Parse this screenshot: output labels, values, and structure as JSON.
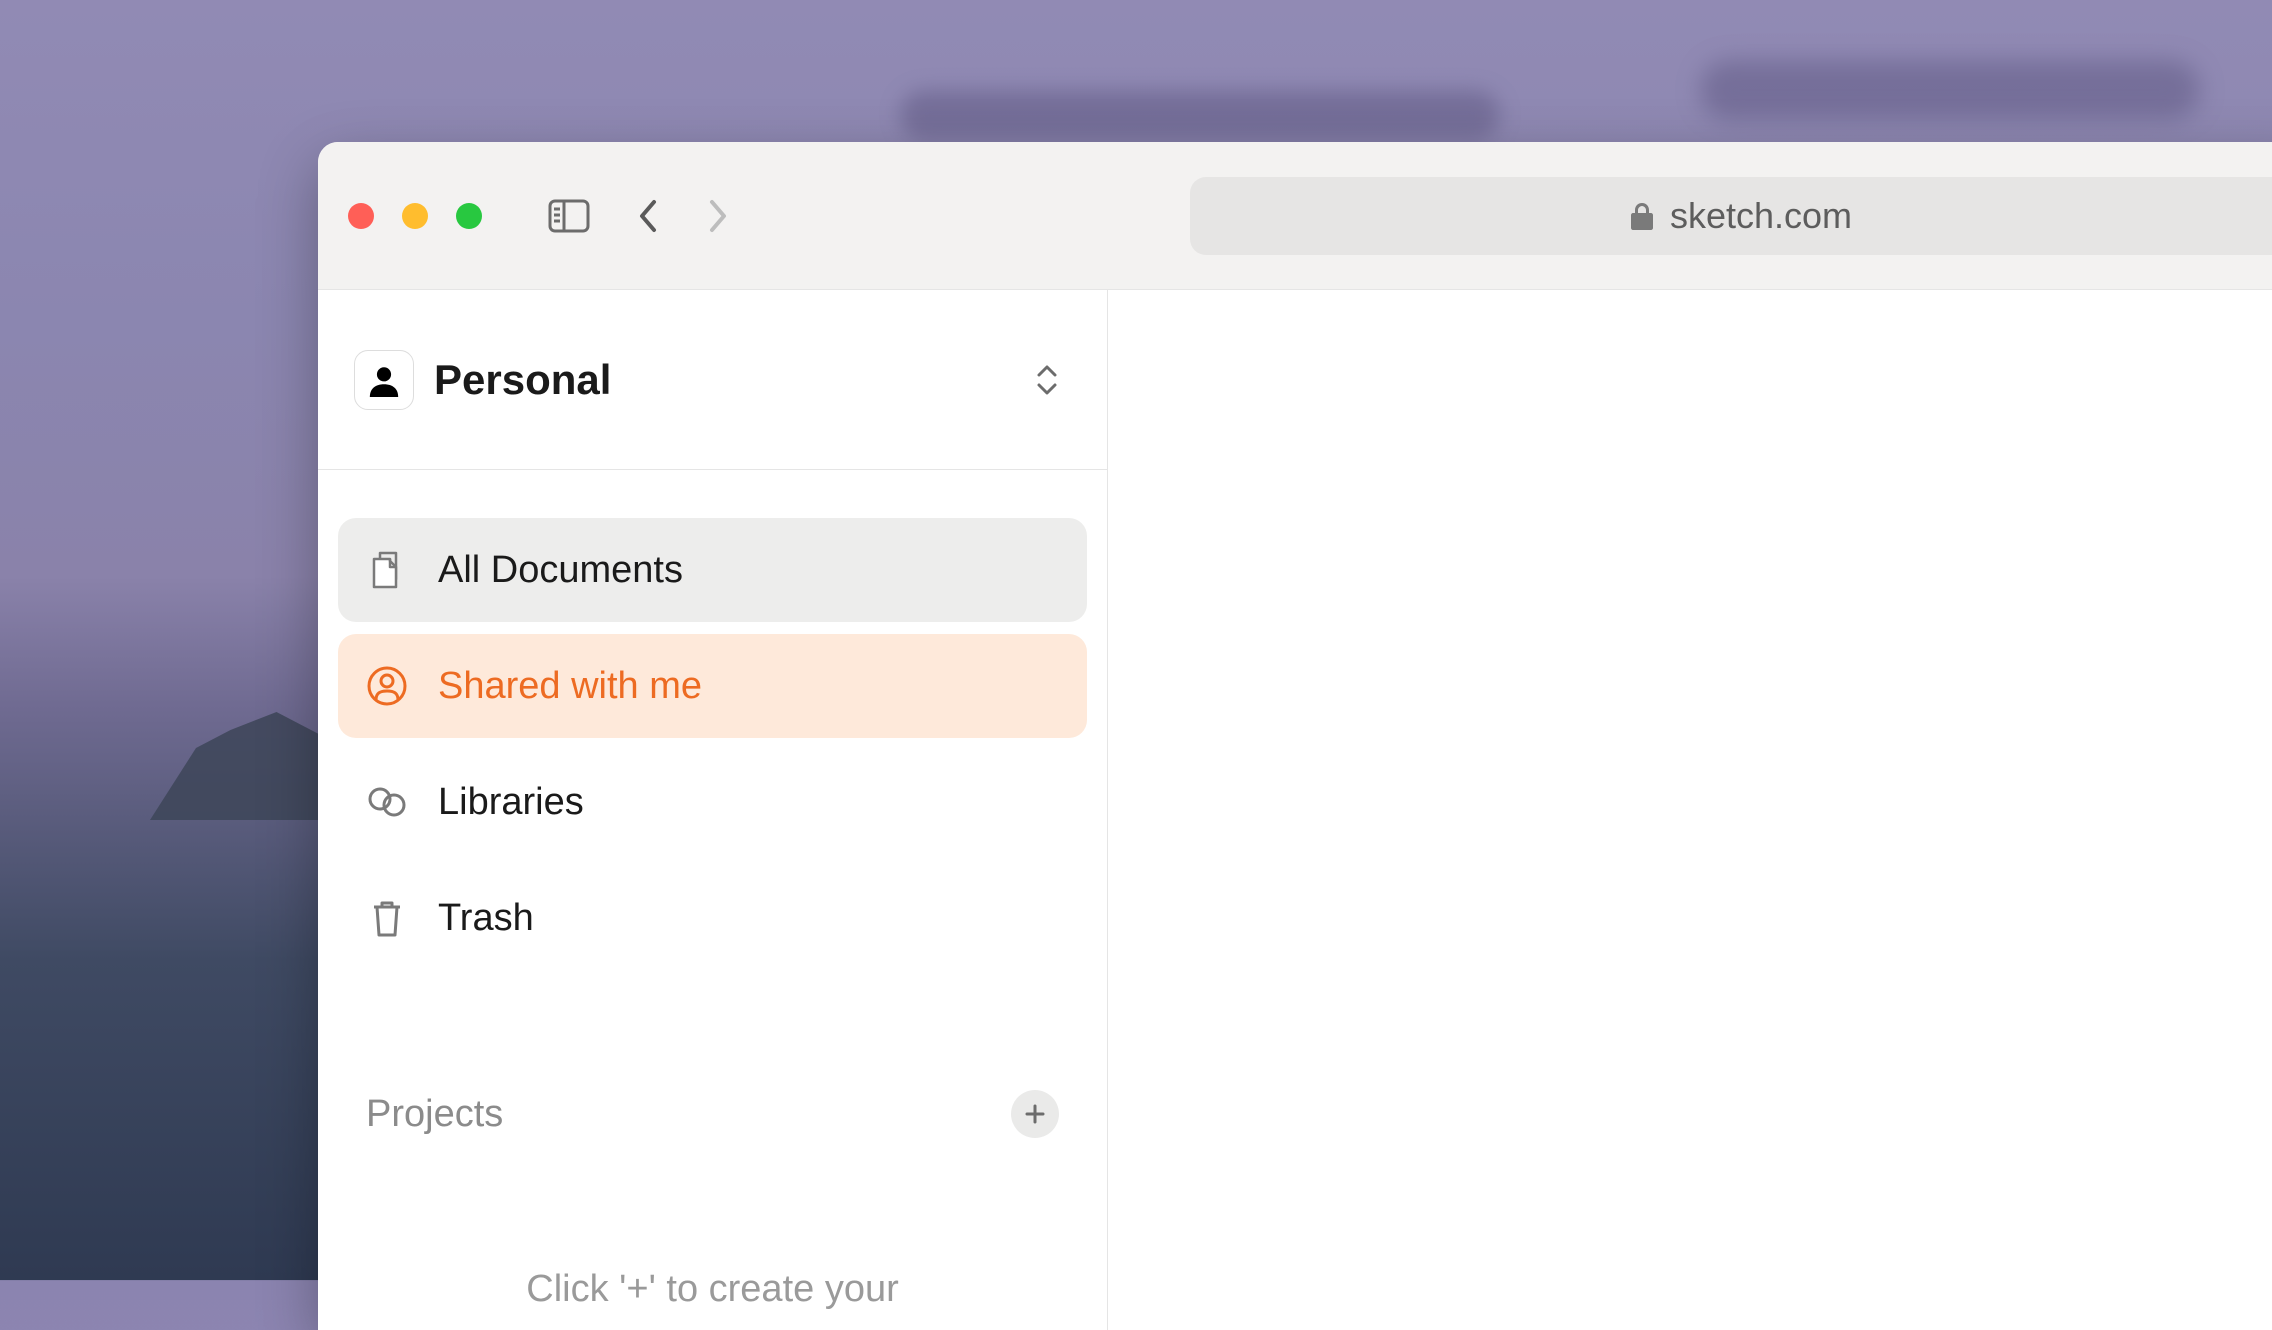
{
  "browser": {
    "url_display": "sketch.com"
  },
  "workspace": {
    "title": "Personal"
  },
  "sidebar": {
    "items": [
      {
        "label": "All Documents"
      },
      {
        "label": "Shared with me"
      },
      {
        "label": "Libraries"
      },
      {
        "label": "Trash"
      }
    ],
    "projects_section_title": "Projects",
    "projects_placeholder": "Click '+' to create your"
  }
}
